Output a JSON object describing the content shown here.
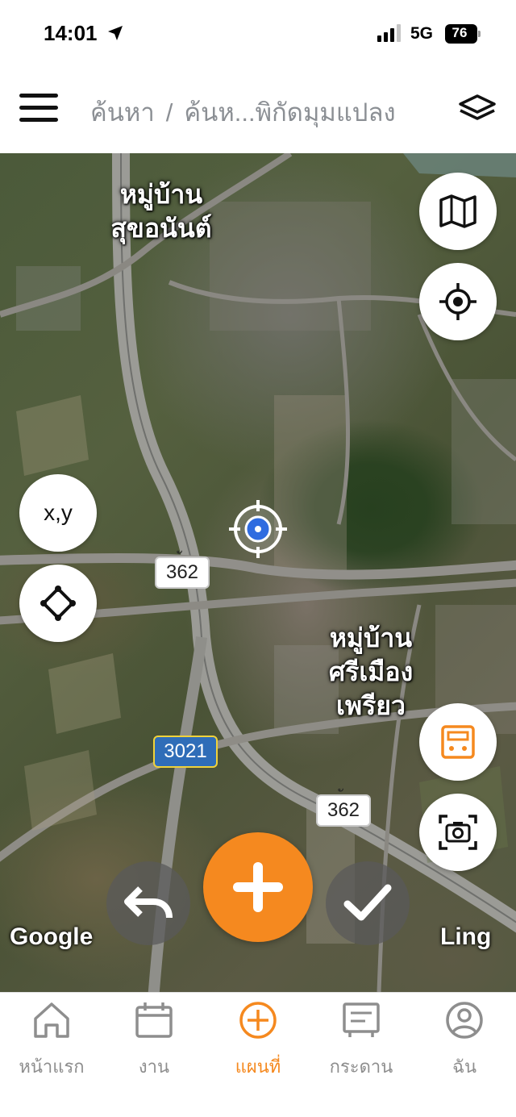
{
  "status_bar": {
    "time": "14:01",
    "network": "5G",
    "battery": "76"
  },
  "header": {
    "breadcrumb_root": "ค้นหา",
    "breadcrumb_separator": "/",
    "breadcrumb_current": "ค้นห...พิกัดมุมแปลง"
  },
  "map": {
    "labels": {
      "village_1": "หมู่บ้าน\nสุขอนันต์",
      "village_2": "หมู่บ้าน\nศรีเมือง\nเพรียว"
    },
    "road_shields": {
      "r362_a": "362",
      "r362_b": "362",
      "r3021": "3021"
    },
    "road_shield_accent": "ั",
    "xy_button": "x,y",
    "credit_left": "Google",
    "credit_right": "Ling",
    "icons": {
      "map_view": "map-icon",
      "locate": "crosshair-icon",
      "polygon": "polygon-icon",
      "calculator": "calculator-icon",
      "screenshot": "camera-icon",
      "undo": "undo-icon",
      "add": "plus-icon",
      "confirm": "check-icon"
    },
    "colors": {
      "accent": "#f5891f",
      "locator": "#2f6ce0"
    }
  },
  "bottom_nav": {
    "items": [
      {
        "label": "หน้าแรก",
        "icon": "home-icon"
      },
      {
        "label": "งาน",
        "icon": "calendar-icon"
      },
      {
        "label": "แผนที่",
        "icon": "plus-circle-icon",
        "active": true
      },
      {
        "label": "กระดาน",
        "icon": "board-icon"
      },
      {
        "label": "ฉัน",
        "icon": "user-icon"
      }
    ]
  }
}
